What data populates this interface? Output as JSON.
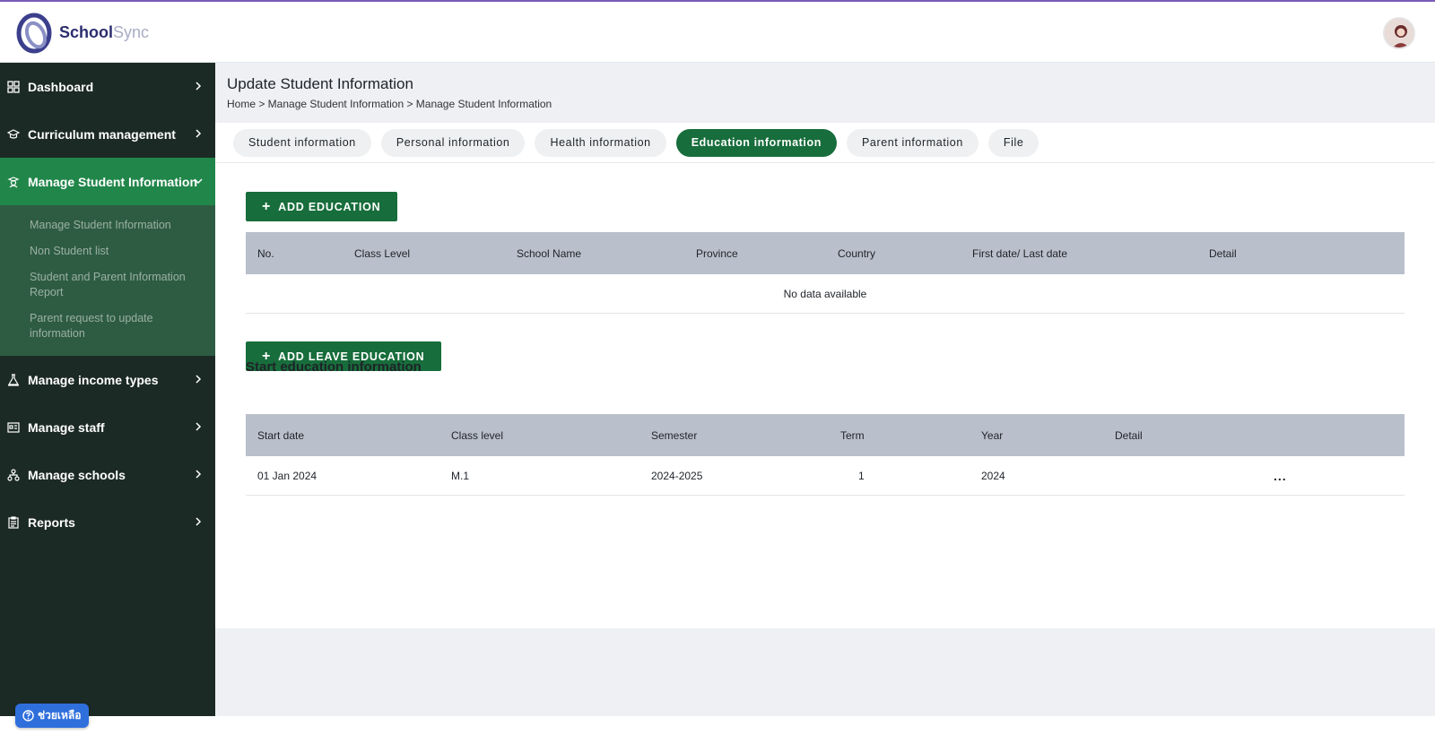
{
  "app": {
    "name_part1": "School",
    "name_part2": "Sync"
  },
  "sidebar": {
    "items": [
      {
        "label": "Dashboard",
        "icon": "grid-icon"
      },
      {
        "label": "Curriculum management",
        "icon": "graduation-cap-icon"
      },
      {
        "label": "Manage Student Information",
        "icon": "student-icon"
      },
      {
        "label": "Manage income types",
        "icon": "flask-icon"
      },
      {
        "label": "Manage staff",
        "icon": "id-card-icon"
      },
      {
        "label": "Manage schools",
        "icon": "hierarchy-icon"
      },
      {
        "label": "Reports",
        "icon": "clipboard-icon"
      }
    ],
    "submenu": [
      "Manage Student Information",
      "Non Student list",
      "Student and Parent Information Report",
      "Parent request to update information"
    ]
  },
  "help": {
    "label": "ช่วยเหลือ"
  },
  "page": {
    "title": "Update Student Information",
    "breadcrumb": "Home > Manage Student Information > Manage Student Information"
  },
  "tabs": [
    "Student information",
    "Personal information",
    "Health information",
    "Education information",
    "Parent information",
    "File"
  ],
  "active_tab": "Education information",
  "education": {
    "add_label": "ADD EDUCATION",
    "headers": [
      "No.",
      "Class Level",
      "School Name",
      "Province",
      "Country",
      "First date/ Last date",
      "Detail"
    ],
    "empty_text": "No data available"
  },
  "leave": {
    "add_label": "ADD LEAVE EDUCATION"
  },
  "start": {
    "title": "Start education information",
    "headers": [
      "Start date",
      "Class level",
      "Semester",
      "Term",
      "Year",
      "Detail"
    ],
    "rows": [
      {
        "start_date": "01 Jan 2024",
        "class_level": "M.1",
        "semester": "2024-2025",
        "term": "1",
        "year": "2024",
        "detail": "..."
      }
    ]
  },
  "colors": {
    "sidebar_bg": "#1c2a26",
    "active_green": "#21864a",
    "button_green": "#176d3b",
    "header_gray": "#b9c0cb"
  }
}
